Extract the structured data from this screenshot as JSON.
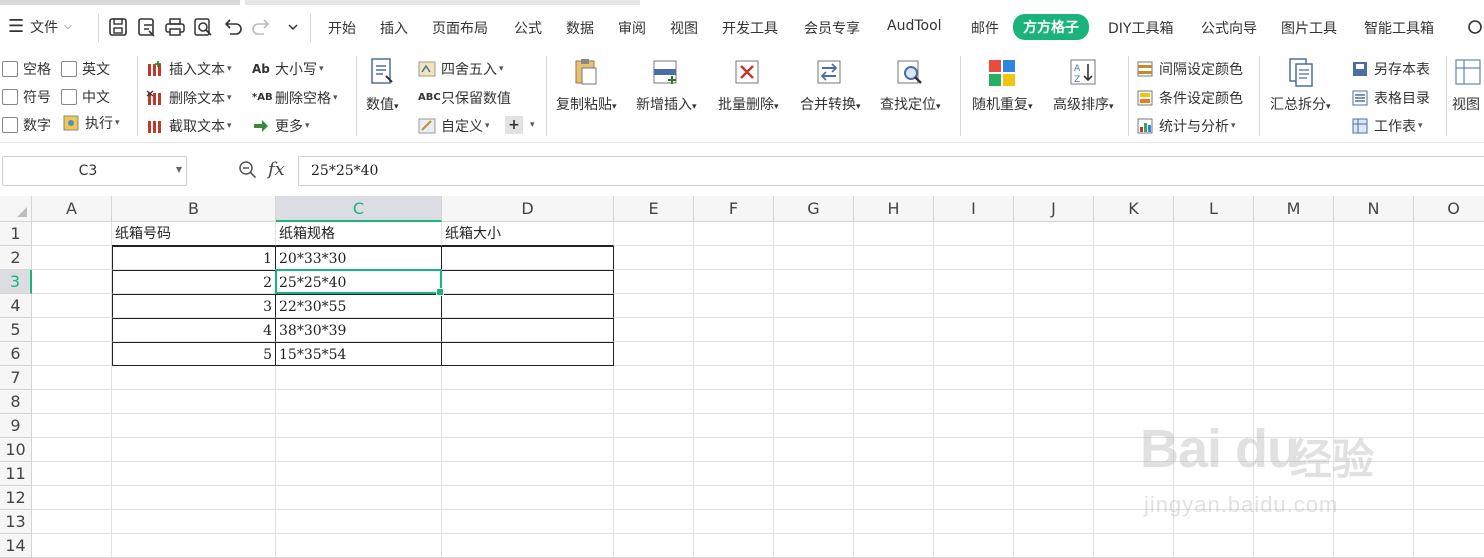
{
  "menu": {
    "file_label": "文件",
    "tabs": [
      "开始",
      "插入",
      "页面布局",
      "公式",
      "数据",
      "审阅",
      "视图",
      "开发工具",
      "会员专享",
      "AudTool",
      "邮件",
      "方方格子",
      "DIY工具箱",
      "公式向导",
      "图片工具",
      "智能工具箱"
    ],
    "active_tab": "方方格子",
    "accent": "#1ab47a"
  },
  "ribbon": {
    "checks": [
      "空格",
      "英文",
      "符号",
      "中文",
      "数字"
    ],
    "execute": "执行",
    "text_ops": [
      "插入文本",
      "删除文本",
      "截取文本"
    ],
    "case_ops": [
      "大小写",
      "删除空格",
      "更多"
    ],
    "value": "数值",
    "num_ops": [
      "四舍五入",
      "只保留数值",
      "自定义"
    ],
    "big_buttons": [
      "复制粘贴",
      "新增插入",
      "批量删除",
      "合并转换",
      "查找定位",
      "随机重复",
      "高级排序"
    ],
    "color_ops": [
      "间隔设定颜色",
      "条件设定颜色",
      "统计与分析"
    ],
    "split": "汇总拆分",
    "sheet_ops": [
      "另存本表",
      "表格目录",
      "工作表"
    ],
    "view": "视图"
  },
  "formula_bar": {
    "name_box": "C3",
    "fx": "fx",
    "formula": "25*25*40"
  },
  "sheet": {
    "columns": [
      "A",
      "B",
      "C",
      "D",
      "E",
      "F",
      "G",
      "H",
      "I",
      "J",
      "K",
      "L",
      "M",
      "N",
      "O"
    ],
    "rows": [
      "1",
      "2",
      "3",
      "4",
      "5",
      "6",
      "7",
      "8",
      "9",
      "10",
      "11",
      "12",
      "13",
      "14"
    ],
    "selected_col": "C",
    "selected_row": "3",
    "headers": [
      "纸箱号码",
      "纸箱规格",
      "纸箱大小"
    ],
    "data": [
      {
        "num": "1",
        "spec": "20*33*30",
        "size": ""
      },
      {
        "num": "2",
        "spec": "25*25*40",
        "size": ""
      },
      {
        "num": "3",
        "spec": "22*30*55",
        "size": ""
      },
      {
        "num": "4",
        "spec": "38*30*39",
        "size": ""
      },
      {
        "num": "5",
        "spec": "15*35*54",
        "size": ""
      }
    ]
  },
  "watermark": {
    "brand": "Bai du",
    "cn": "经验",
    "url": "jingyan.baidu.com"
  }
}
